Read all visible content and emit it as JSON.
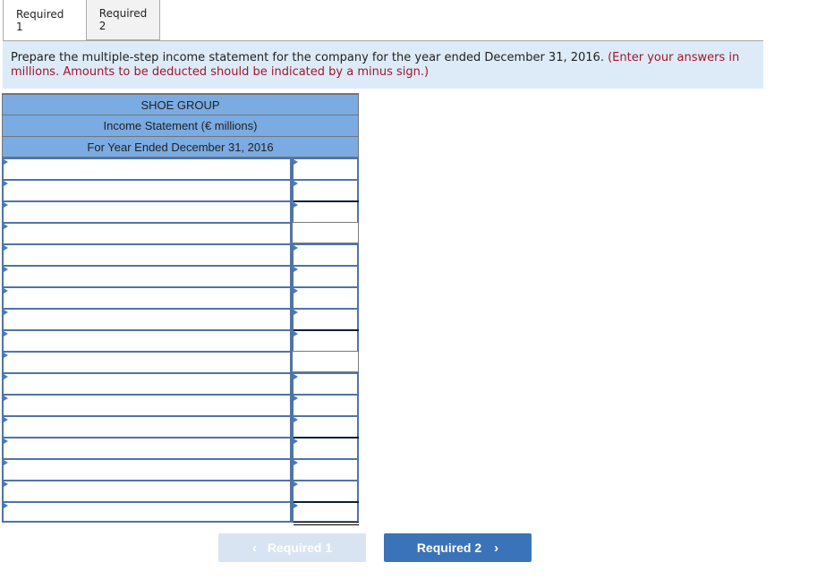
{
  "tabs": [
    {
      "label": "Required 1",
      "active": true
    },
    {
      "label": "Required 2",
      "active": false
    }
  ],
  "instructions": {
    "text": "Prepare the multiple-step income statement for the company for the year ended December 31, 2016.",
    "note": "(Enter your answers in millions. Amounts to be deducted should be indicated by a minus sign.)"
  },
  "statement": {
    "company": "SHOE GROUP",
    "title": "Income Statement (€ millions)",
    "period": "For Year Ended December 31, 2016",
    "rows": [
      {
        "label": "",
        "amount": "",
        "amount_input": true,
        "top_rule": false
      },
      {
        "label": "",
        "amount": "",
        "amount_input": true,
        "top_rule": false
      },
      {
        "label": "",
        "amount": "",
        "amount_input": true,
        "top_rule": true
      },
      {
        "label": "",
        "amount": "",
        "amount_input": false,
        "top_rule": false
      },
      {
        "label": "",
        "amount": "",
        "amount_input": true,
        "top_rule": false
      },
      {
        "label": "",
        "amount": "",
        "amount_input": true,
        "top_rule": false
      },
      {
        "label": "",
        "amount": "",
        "amount_input": true,
        "top_rule": false
      },
      {
        "label": "",
        "amount": "",
        "amount_input": true,
        "top_rule": false
      },
      {
        "label": "",
        "amount": "",
        "amount_input": true,
        "top_rule": true
      },
      {
        "label": "",
        "amount": "",
        "amount_input": false,
        "top_rule": false
      },
      {
        "label": "",
        "amount": "",
        "amount_input": true,
        "top_rule": false
      },
      {
        "label": "",
        "amount": "",
        "amount_input": true,
        "top_rule": false
      },
      {
        "label": "",
        "amount": "",
        "amount_input": true,
        "top_rule": false
      },
      {
        "label": "",
        "amount": "",
        "amount_input": true,
        "top_rule": true
      },
      {
        "label": "",
        "amount": "",
        "amount_input": true,
        "top_rule": false
      },
      {
        "label": "",
        "amount": "",
        "amount_input": true,
        "top_rule": false
      },
      {
        "label": "",
        "amount": "",
        "amount_input": true,
        "top_rule": true,
        "double_underline": true
      }
    ]
  },
  "nav": {
    "prev_label": "Required 1",
    "prev_enabled": false,
    "next_label": "Required 2",
    "next_enabled": true,
    "prev_icon": "chevron-left-icon",
    "next_icon": "chevron-right-icon"
  },
  "colors": {
    "header_bg": "#7aabe2",
    "instruction_bg": "#dcebf7",
    "note_red": "#a5152c",
    "next_button": "#3b73b9",
    "prev_button_disabled": "#d8e4f1"
  }
}
